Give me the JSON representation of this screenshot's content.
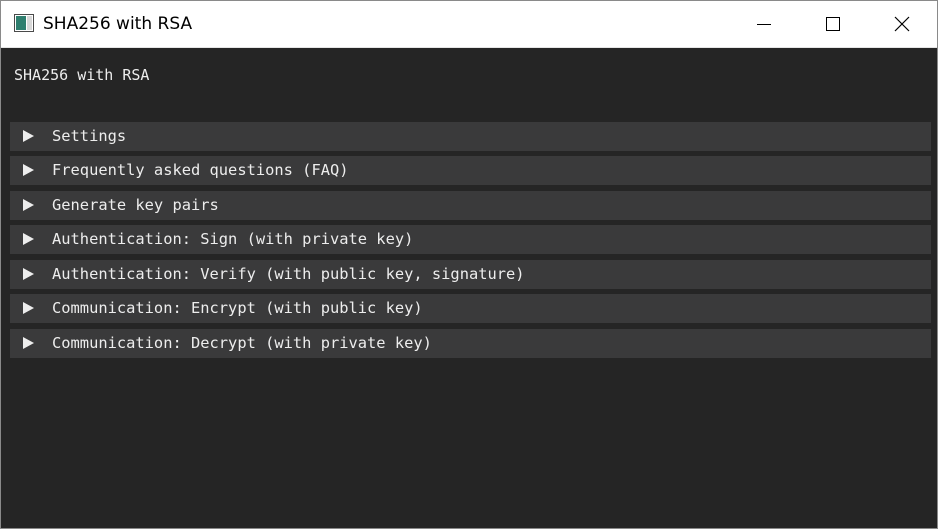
{
  "window": {
    "title": "SHA256 with RSA"
  },
  "main": {
    "heading": "SHA256 with RSA",
    "sections": [
      {
        "label": "Settings"
      },
      {
        "label": "Frequently asked questions (FAQ)"
      },
      {
        "label": "Generate key pairs"
      },
      {
        "label": "Authentication: Sign (with private key)"
      },
      {
        "label": "Authentication: Verify (with public key, signature)"
      },
      {
        "label": "Communication: Encrypt (with public key)"
      },
      {
        "label": "Communication: Decrypt (with private key)"
      }
    ]
  },
  "icons": {
    "app": "app-window-icon",
    "minimize": "minimize-icon",
    "maximize": "maximize-icon",
    "close": "close-icon",
    "collapsed": "triangle-right-icon"
  },
  "colors": {
    "background": "#252525",
    "section_header": "#3a3a3b",
    "text": "#ededed",
    "titlebar": "#ffffff"
  }
}
